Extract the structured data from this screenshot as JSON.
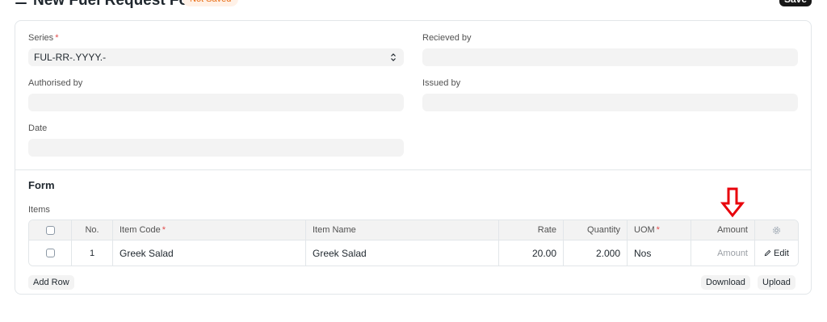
{
  "header": {
    "title": "New Fuel Request Form",
    "status": "Not Saved",
    "save_label": "Save"
  },
  "fields": {
    "series": {
      "label": "Series",
      "required": "*",
      "value": "FUL-RR-.YYYY.-"
    },
    "received_by": {
      "label": "Recieved by",
      "value": ""
    },
    "authorised_by": {
      "label": "Authorised by",
      "value": ""
    },
    "issued_by": {
      "label": "Issued by",
      "value": ""
    },
    "date": {
      "label": "Date",
      "value": ""
    }
  },
  "section": {
    "title": "Form"
  },
  "items": {
    "label": "Items",
    "columns": {
      "no": "No.",
      "item_code": "Item Code",
      "item_name": "Item Name",
      "rate": "Rate",
      "quantity": "Quantity",
      "uom": "UOM",
      "amount": "Amount"
    },
    "required_mark": "*",
    "rows": [
      {
        "no": "1",
        "item_code": "Greek Salad",
        "item_name": "Greek Salad",
        "rate": "20.00",
        "quantity": "2.000",
        "uom": "Nos",
        "amount": "Amount",
        "edit": "Edit"
      }
    ],
    "add_row": "Add Row",
    "download": "Download",
    "upload": "Upload"
  },
  "annotation": {
    "color": "#e8000b",
    "icon": "down-arrow-outline-icon"
  }
}
